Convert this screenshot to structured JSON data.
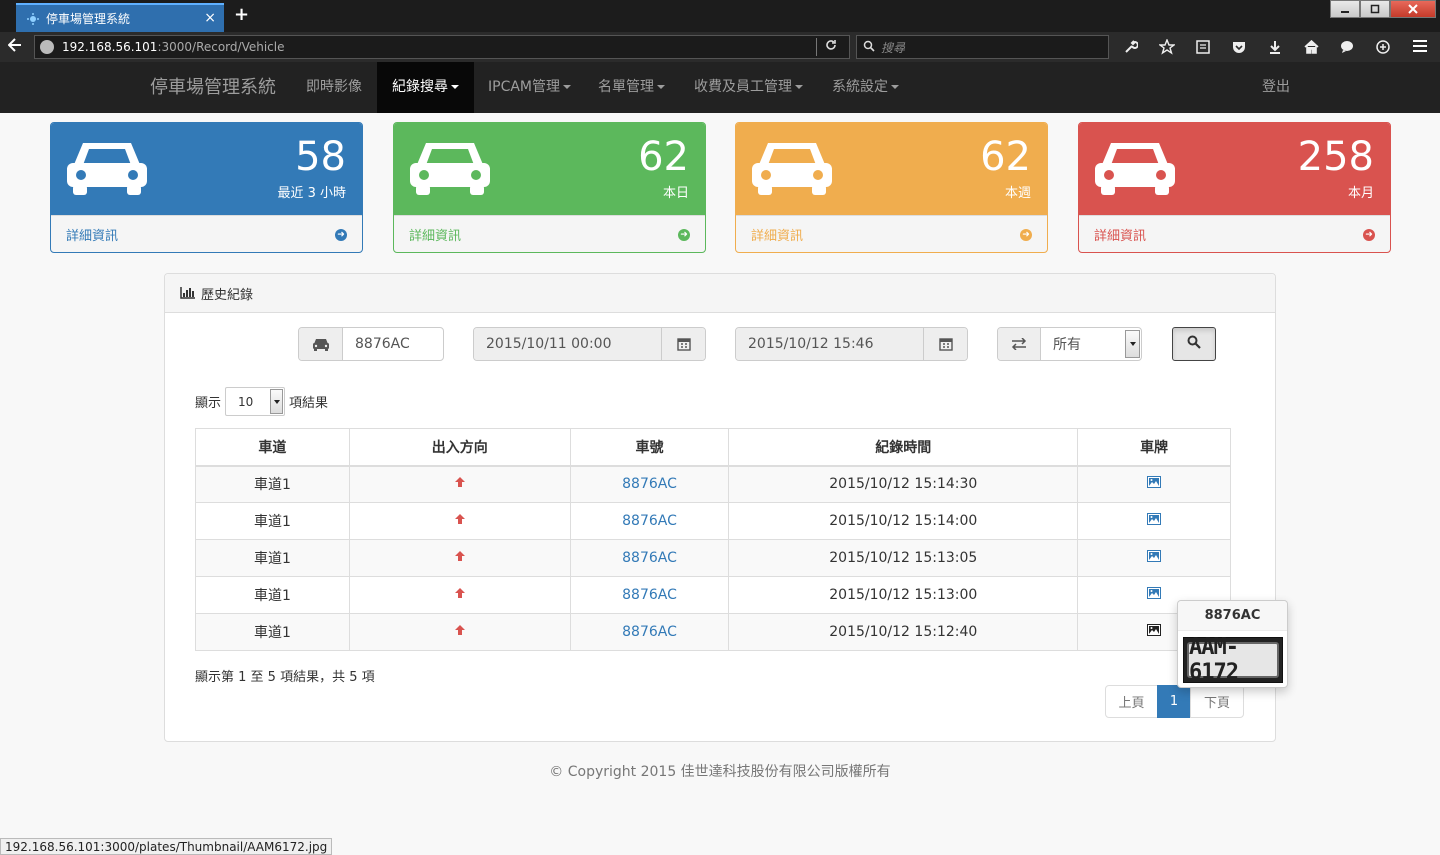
{
  "browser": {
    "tab_title": "停車場管理系統",
    "close_glyph": "×",
    "newtab_glyph": "+",
    "url_host": "192.168.56.101",
    "url_path": ":3000/Record/Vehicle",
    "search_placeholder": "搜尋",
    "status_url": "192.168.56.101:3000/plates/Thumbnail/AAM6172.jpg"
  },
  "nav": {
    "brand": "停車場管理系統",
    "items": [
      {
        "label": "即時影像"
      },
      {
        "label": "紀錄搜尋"
      },
      {
        "label": "IPCAM管理"
      },
      {
        "label": "名單管理"
      },
      {
        "label": "收費及員工管理"
      },
      {
        "label": "系統設定"
      }
    ],
    "logout": "登出"
  },
  "stats": [
    {
      "value": "58",
      "label": "最近 3 小時",
      "link": "詳細資訊",
      "color": "#337ab7"
    },
    {
      "value": "62",
      "label": "本日",
      "link": "詳細資訊",
      "color": "#5cb85c"
    },
    {
      "value": "62",
      "label": "本週",
      "link": "詳細資訊",
      "color": "#f0ad4e"
    },
    {
      "value": "258",
      "label": "本月",
      "link": "詳細資訊",
      "color": "#d9534f"
    }
  ],
  "panel": {
    "title": "歷史紀錄",
    "plate_value": "8876AC",
    "start_value": "2015/10/11 00:00",
    "end_value": "2015/10/12 15:46",
    "direction_value": "所有",
    "length_prefix": "顯示",
    "length_value": "10",
    "length_suffix": "項結果",
    "info": "顯示第 1 至 5 項結果，共 5 項",
    "prev": "上頁",
    "page": "1",
    "next": "下頁"
  },
  "table": {
    "headers": [
      "車道",
      "出入方向",
      "車號",
      "紀錄時間",
      "車牌"
    ],
    "rows": [
      {
        "lane": "車道1",
        "plate": "8876AC",
        "time": "2015/10/12 15:14:30"
      },
      {
        "lane": "車道1",
        "plate": "8876AC",
        "time": "2015/10/12 15:14:00"
      },
      {
        "lane": "車道1",
        "plate": "8876AC",
        "time": "2015/10/12 15:13:05"
      },
      {
        "lane": "車道1",
        "plate": "8876AC",
        "time": "2015/10/12 15:13:00"
      },
      {
        "lane": "車道1",
        "plate": "8876AC",
        "time": "2015/10/12 15:12:40"
      }
    ]
  },
  "popover": {
    "title": "8876AC",
    "plate_text": "AAM-6172"
  },
  "footer": "© Copyright 2015 佳世達科技股份有限公司版權所有",
  "icons": {
    "car": "car-icon",
    "circle_arrow": "circle-arrow-right-icon",
    "calendar": "calendar-icon",
    "swap": "swap-icon",
    "search": "search-icon",
    "up": "arrow-up-icon",
    "picture": "picture-icon",
    "chart": "bar-chart-icon"
  }
}
